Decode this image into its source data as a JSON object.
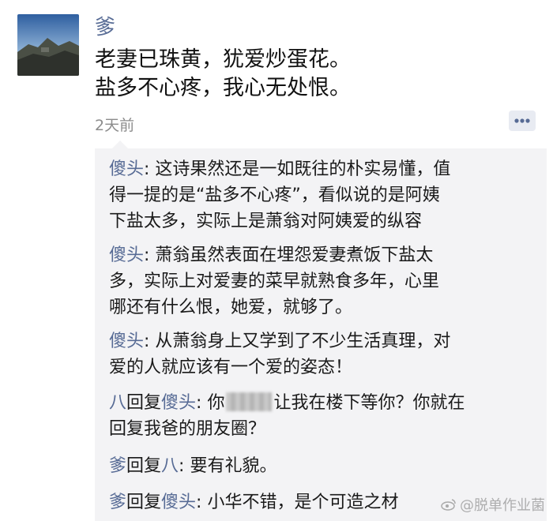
{
  "post": {
    "author": "爹",
    "lines": [
      "老妻已珠黄，犹爱炒蛋花。",
      "盐多不心疼，我心无处恨。"
    ],
    "time": "2天前",
    "more_icon": "comment-dots-icon"
  },
  "comments": [
    {
      "name": "傻头",
      "lines": [
        "这诗果然还是一如既往的朴实易懂，值",
        "得一提的是“盐多不心疼”，看似说的是阿姨",
        "下盐太多，实际上是萧翁对阿姨爱的纵容"
      ]
    },
    {
      "name": "傻头",
      "lines": [
        "萧翁虽然表面在埋怨爱妻煮饭下盐太",
        "多，实际上对爱妻的菜早就熟食多年，心里",
        "哪还有什么恨，她爱，就够了。"
      ]
    },
    {
      "name": "傻头",
      "lines": [
        "从萧翁身上又学到了不少生活真理，对",
        "爱的人就应该有一个爱的姿态！"
      ]
    },
    {
      "from": "八",
      "reply_word": "回复",
      "to": "傻头",
      "text_before": "你",
      "text_after": "让我在楼下等你？你就在",
      "line2": "回复我爸的朋友圈？"
    },
    {
      "from": "爹",
      "reply_word": "回复",
      "to": "八",
      "text": "要有礼貌。"
    },
    {
      "from": "爹",
      "reply_word": "回复",
      "to": "傻头",
      "text": "小华不错，是个可造之材"
    }
  ],
  "watermark": "@脱单作业菌"
}
